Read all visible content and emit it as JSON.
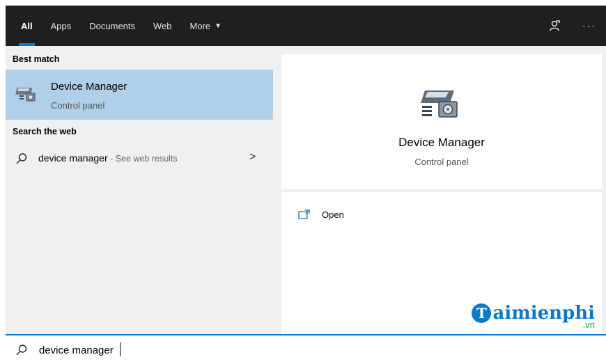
{
  "tabs": [
    {
      "label": "All",
      "active": true
    },
    {
      "label": "Apps",
      "active": false
    },
    {
      "label": "Documents",
      "active": false
    },
    {
      "label": "Web",
      "active": false
    },
    {
      "label": "More",
      "active": false
    }
  ],
  "top_actions": {
    "feedback_icon": "feedback-icon",
    "more_label": "···"
  },
  "left": {
    "best_match_label": "Best match",
    "best_match": {
      "title": "Device Manager",
      "subtitle": "Control panel",
      "icon": "device-manager-icon"
    },
    "search_web_label": "Search the web",
    "web_item": {
      "query": "device manager",
      "suffix": " - See web results",
      "chevron": ">"
    }
  },
  "right": {
    "title": "Device Manager",
    "subtitle": "Control panel",
    "open_label": "Open"
  },
  "watermark": {
    "letter": "T",
    "text": "aimienphi",
    "domain": ".vn"
  },
  "search": {
    "value": "device manager"
  },
  "colors": {
    "accent": "#0078d7",
    "selected": "#b0cfe8",
    "topbar": "#1f1f1f"
  }
}
